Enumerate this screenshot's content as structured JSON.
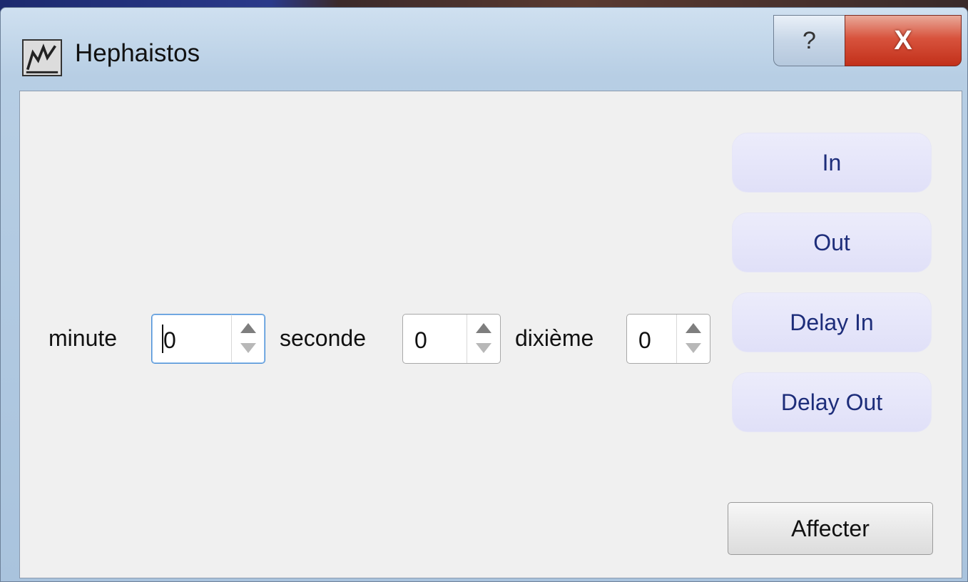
{
  "window": {
    "title": "Hephaistos",
    "help_glyph": "?",
    "close_glyph": "X"
  },
  "fields": {
    "minute": {
      "label": "minute",
      "value": "0"
    },
    "seconde": {
      "label": "seconde",
      "value": "0"
    },
    "dixieme": {
      "label": "dixième",
      "value": "0"
    }
  },
  "buttons": {
    "in": "In",
    "out": "Out",
    "delay_in": "Delay In",
    "delay_out": "Delay Out",
    "affecter": "Affecter"
  },
  "icons": {
    "app": "app-logo-icon",
    "help": "help-icon",
    "close": "close-icon",
    "spin_up": "spin-up-arrow-icon",
    "spin_down": "spin-down-arrow-icon"
  },
  "colors": {
    "close_button": "#c2301a",
    "action_button_bg": "#e4e4f8",
    "action_button_text": "#1d2d7a",
    "client_bg": "#f0f0f0",
    "focus_border": "#4a8fd6"
  }
}
